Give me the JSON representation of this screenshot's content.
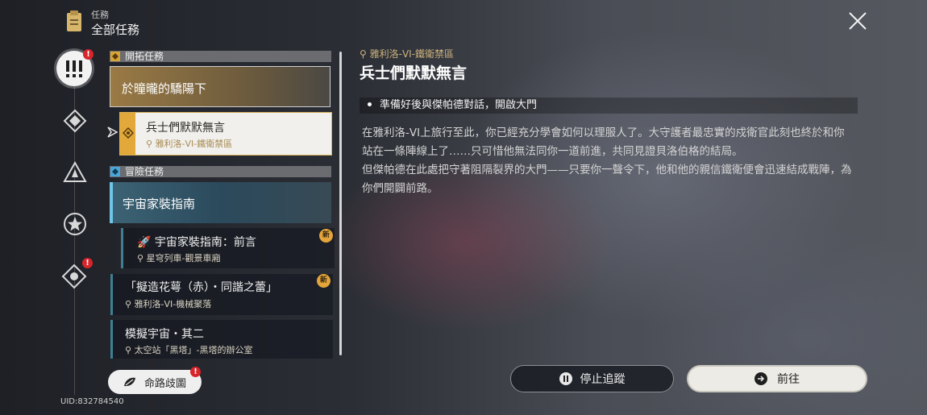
{
  "header": {
    "category": "任務",
    "title": "全部任務",
    "clipboard_icon": "clipboard-icon",
    "close_icon": "close-icon"
  },
  "sidebar": {
    "items": [
      {
        "icon": "exclamation-icon",
        "active": true,
        "badge": "!"
      },
      {
        "icon": "trailblaze-icon",
        "active": false
      },
      {
        "icon": "triangle-star-icon",
        "active": false
      },
      {
        "icon": "star-icon",
        "active": false
      },
      {
        "icon": "diamond-compass-icon",
        "active": false,
        "badge": "!"
      }
    ]
  },
  "quests": {
    "trailblaze_section": "開拓任務",
    "trailblaze_main": "於曈曨的驕陽下",
    "selected": {
      "title": "兵士們默默無言",
      "location": "雅利洛-VI-鐵衛禁區"
    },
    "adventure_section": "冒險任務",
    "adventure_main": "宇宙家裝指南",
    "sub_a": {
      "title": "宇宙家裝指南：前言",
      "location": "星穹列車-觀景車廂",
      "badge": "新"
    },
    "sub_b": {
      "title": "「擬造花萼（赤）・同諧之蕾」",
      "location": "雅利洛-VI-機械聚落",
      "badge": "新"
    },
    "sub_c": {
      "title": "模擬宇宙・其二",
      "location": "太空站「黑塔」-黑塔的辦公室"
    }
  },
  "detail": {
    "location": "雅利洛-VI-鐵衛禁區",
    "title": "兵士們默默無言",
    "objective": "準備好後與傑帕德對話，開啟大門",
    "description": [
      "在雅利洛-VI上旅行至此，你已經充分學會如何以理服人了。大守護者最忠實的戍衛官此刻也終於和你站在一條陣線上了……只可惜他無法同你一道前進，共同見證貝洛伯格的結局。",
      "但傑帕德在此處把守著阻隔裂界的大門——只要你一聲令下，他和他的親信鐵衛便會迅速結成戰陣，為你們開闢前路。"
    ]
  },
  "footer": {
    "uid": "UID:832784540",
    "map_button": "命路歧圖",
    "map_badge": "!",
    "stop_button": "停止追蹤",
    "go_button": "前往"
  },
  "colors": {
    "accent_gold": "#e2a93a",
    "adventure_blue": "#6fc4e8",
    "alert_red": "#d8252b"
  }
}
